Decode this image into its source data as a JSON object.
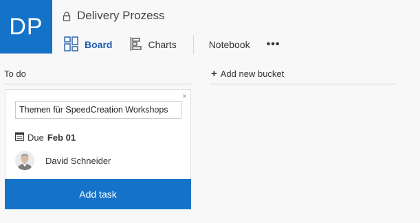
{
  "plan": {
    "initials": "DP",
    "title": "Delivery Prozess",
    "accent_color": "#1473c9"
  },
  "nav": {
    "board_label": "Board",
    "charts_label": "Charts",
    "notebook_label": "Notebook",
    "more_label": "•••"
  },
  "buckets": {
    "todo_title": "To do",
    "add_new_label": "Add new bucket",
    "add_new_icon": "+"
  },
  "new_task": {
    "title_value": "Themen für SpeedCreation Workshops",
    "close_icon": "×",
    "due_prefix": "Due",
    "due_date": "Feb 01",
    "assignee": "David Schneider",
    "add_button": "Add task"
  }
}
